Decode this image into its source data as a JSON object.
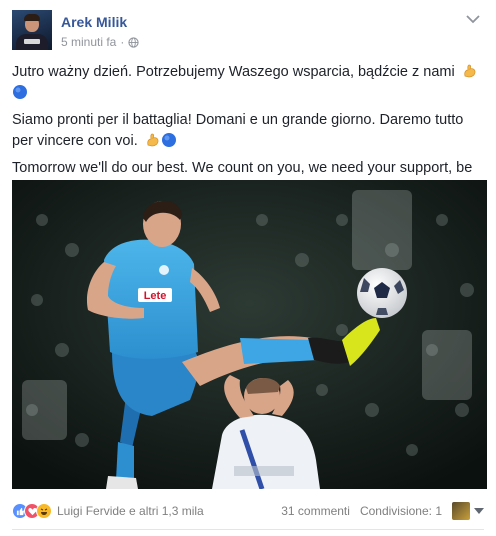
{
  "post": {
    "author": "Arek Milik",
    "timestamp": "5 minuti fa",
    "separator": "·",
    "privacy_icon": "globe-icon",
    "menu_icon": "chevron-down-icon",
    "paragraphs": [
      "Jutro ważny dzień. Potrzebujemy Waszego wsparcia, bądźcie z nami",
      "Siamo pronti per il battaglia! Domani e un grande giorno. Daremo tutto per vincere con voi.",
      "Tomorrow we'll do our best. We count on you, we need your support, be with us."
    ],
    "emojis": [
      "flexed-biceps-icon",
      "blue-circle-icon"
    ],
    "photo_shirt_text": "Lete"
  },
  "footer": {
    "reaction_icons": [
      "like-icon",
      "love-icon",
      "haha-icon"
    ],
    "reactions_text": "Luigi Fervide e altri 1,3 mila",
    "comments_text": "31 commenti",
    "shares_text": "Condivisione: 1"
  },
  "colors": {
    "author_link": "#365899",
    "meta_gray": "#90949c",
    "napoli_blue": "#3fa5e0",
    "like_blue": "#5890ff",
    "love_red": "#f25268",
    "haha_yellow": "#f7b928"
  }
}
